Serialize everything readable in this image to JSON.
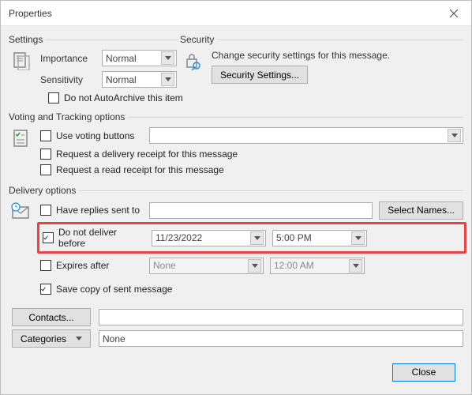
{
  "window": {
    "title": "Properties"
  },
  "settings": {
    "legend": "Settings",
    "importance_label": "Importance",
    "importance_value": "Normal",
    "sensitivity_label": "Sensitivity",
    "sensitivity_value": "Normal",
    "autoarchive_label": "Do not AutoArchive this item"
  },
  "security": {
    "legend": "Security",
    "desc": "Change security settings for this message.",
    "button": "Security Settings..."
  },
  "voting": {
    "legend": "Voting and Tracking options",
    "use_voting_label": "Use voting buttons",
    "delivery_receipt_label": "Request a delivery receipt for this message",
    "read_receipt_label": "Request a read receipt for this message"
  },
  "delivery": {
    "legend": "Delivery options",
    "have_replies_label": "Have replies sent to",
    "have_replies_value": "",
    "select_names_btn": "Select Names...",
    "do_not_deliver_label": "Do not deliver before",
    "do_not_deliver_date": "11/23/2022",
    "do_not_deliver_time": "5:00 PM",
    "expires_label": "Expires after",
    "expires_date": "None",
    "expires_time": "12:00 AM",
    "save_copy_label": "Save copy of sent message"
  },
  "contacts": {
    "button": "Contacts...",
    "value": ""
  },
  "categories": {
    "button": "Categories",
    "value": "None"
  },
  "footer": {
    "close": "Close"
  }
}
